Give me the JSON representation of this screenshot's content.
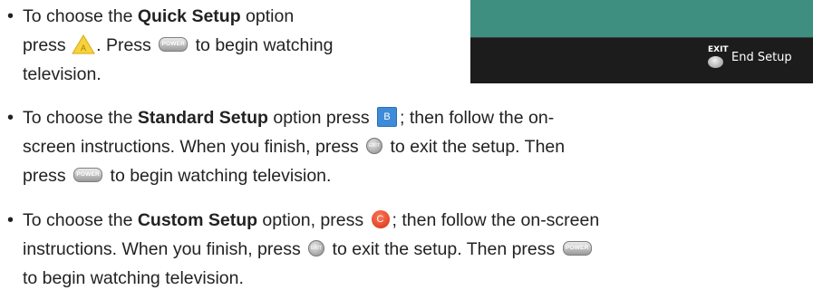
{
  "items": [
    {
      "line1_pre": "To choose the ",
      "bold": "Quick Setup",
      "line1_post": " option",
      "line2_pre": "press ",
      "icon_a": "A",
      "line2_mid": ". Press ",
      "icon_power": "POWER",
      "line2_post": " to begin watching",
      "line3": "television."
    },
    {
      "line1_pre": "To choose the ",
      "bold": "Standard Setup",
      "line1_mid": " option press ",
      "icon_b": "B",
      "line1_post": "; then follow the on-",
      "line2_pre": "screen instructions. When you finish, press ",
      "icon_exit": "EXIT",
      "line2_post": " to exit the setup. Then",
      "line3_pre": "press ",
      "icon_power": "POWER",
      "line3_post": " to begin watching television."
    },
    {
      "line1_pre": "To choose the ",
      "bold": "Custom Setup",
      "line1_mid": " option, press ",
      "icon_c": "C",
      "line1_post": "; then follow the on-screen",
      "line2_pre": "instructions. When you finish, press ",
      "icon_exit": "EXIT",
      "line2_mid": " to exit the setup. Then press ",
      "icon_power": "POWER",
      "line3": "to begin watching television."
    }
  ],
  "tv": {
    "exit_label": "EXIT",
    "end_setup_label": "End Setup"
  },
  "colors": {
    "tv_teal": "#3f8f80",
    "tv_dark": "#1c1c1c",
    "b_blue": "#3d8bd9",
    "c_red": "#d62e12",
    "a_yellow": "#f6d33c"
  }
}
